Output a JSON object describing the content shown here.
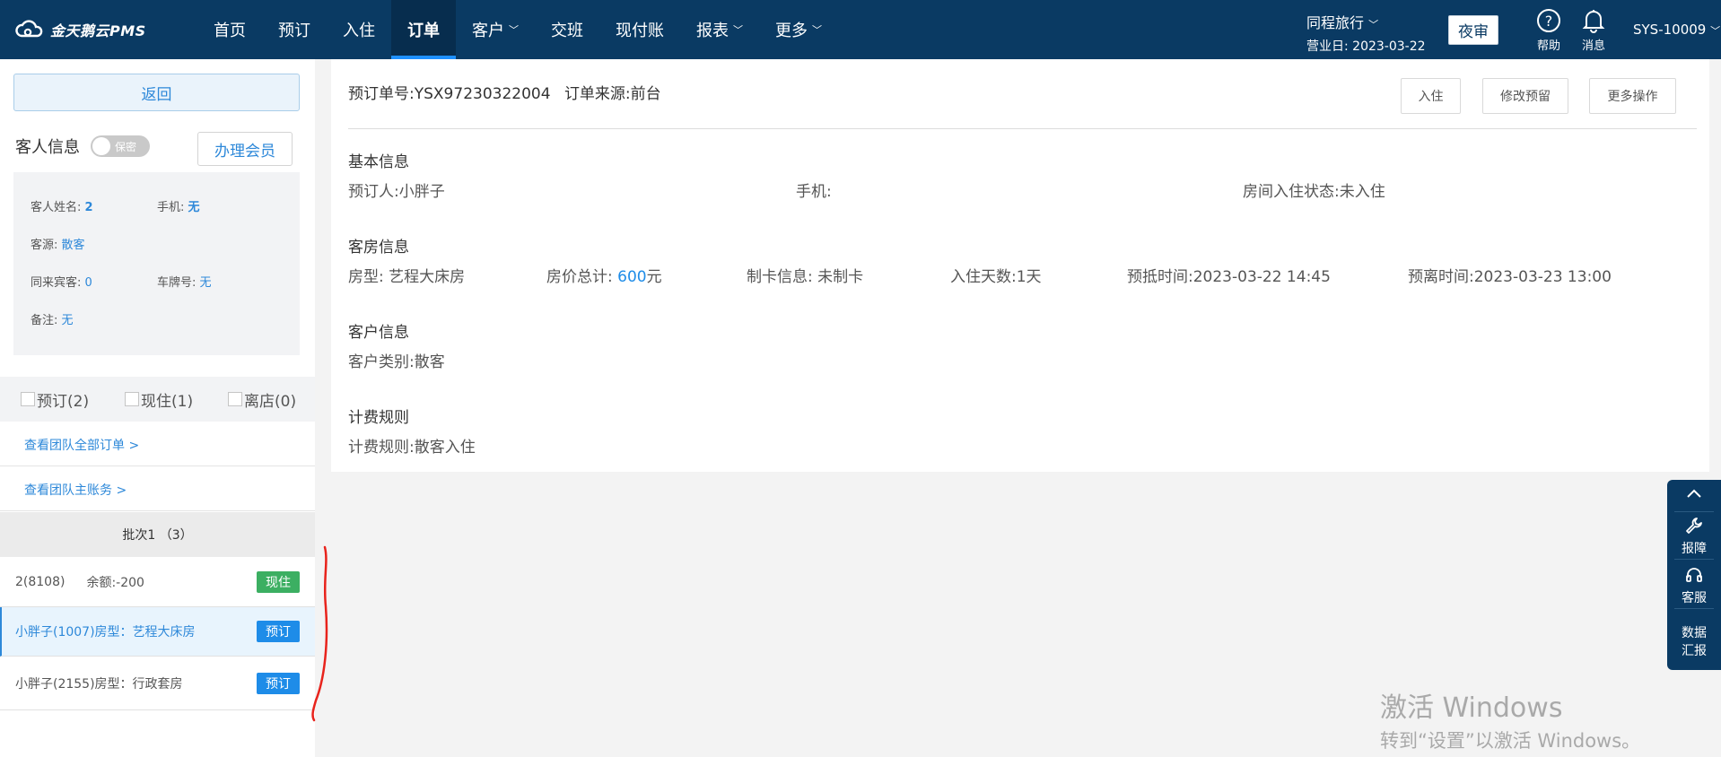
{
  "app": {
    "logo_text": "金天鹅云PMS"
  },
  "nav": {
    "items": [
      {
        "label": "首页",
        "has_caret": false,
        "active": false
      },
      {
        "label": "预订",
        "has_caret": false,
        "active": false
      },
      {
        "label": "入住",
        "has_caret": false,
        "active": false
      },
      {
        "label": "订单",
        "has_caret": false,
        "active": true
      },
      {
        "label": "客户",
        "has_caret": true,
        "active": false
      },
      {
        "label": "交班",
        "has_caret": false,
        "active": false
      },
      {
        "label": "现付账",
        "has_caret": false,
        "active": false
      },
      {
        "label": "报表",
        "has_caret": true,
        "active": false
      },
      {
        "label": "更多",
        "has_caret": true,
        "active": false
      }
    ]
  },
  "header_right": {
    "hotel_name": "同程旅行",
    "business_date_label": "营业日:",
    "business_date": "2023-03-22",
    "night_audit": "夜审",
    "help": "帮助",
    "messages": "消息",
    "user": "SYS-10009"
  },
  "sidebar": {
    "back": "返回",
    "guest_info_title": "客人信息",
    "privacy_toggle": "保密",
    "member_button": "办理会员",
    "guest": {
      "name_label": "客人姓名:",
      "name_value": "2",
      "phone_label": "手机:",
      "phone_value": "无",
      "source_label": "客源:",
      "source_value": "散客",
      "companions_label": "同来宾客:",
      "companions_value": "0",
      "plate_label": "车牌号:",
      "plate_value": "无",
      "remark_label": "备注:",
      "remark_value": "无"
    },
    "filters": [
      {
        "label": "预订(2)",
        "checked": false
      },
      {
        "label": "现住(1)",
        "checked": false
      },
      {
        "label": "离店(0)",
        "checked": false
      }
    ],
    "team_all_orders": "查看团队全部订单 >",
    "team_master_account": "查看团队主账务 >",
    "batch_label": "批次1 （3）",
    "rooms": [
      {
        "text": "2(8108)",
        "extra": "余额:-200",
        "tag": "现住",
        "tag_color": "#3caf62",
        "selected": false
      },
      {
        "text": "小胖子(1007)房型：艺程大床房",
        "extra": "",
        "tag": "预订",
        "tag_color": "#1e8ce8",
        "selected": true
      },
      {
        "text": "小胖子(2155)房型：行政套房",
        "extra": "",
        "tag": "预订",
        "tag_color": "#1e8ce8",
        "selected": false
      }
    ]
  },
  "order": {
    "number_label": "预订单号:",
    "number": "YSX97230322004",
    "source_label": "订单来源:",
    "source": "前台",
    "buttons": {
      "checkin": "入住",
      "modify": "修改预留",
      "more": "更多操作"
    }
  },
  "basic_info": {
    "title": "基本信息",
    "booker_label": "预订人:",
    "booker": "小胖子",
    "phone_label": "手机:",
    "phone": "",
    "status_label": "房间入住状态:",
    "status": "未入住"
  },
  "room_info": {
    "title": "客房信息",
    "type_label": "房型:",
    "type": "艺程大床房",
    "total_label": "房价总计:",
    "total": "600",
    "total_unit": "元",
    "card_label": "制卡信息:",
    "card": "未制卡",
    "days_label": "入住天数:",
    "days": "1天",
    "arrive_label": "预抵时间:",
    "arrive": "2023-03-22 14:45",
    "depart_label": "预离时间:",
    "depart": "2023-03-23 13:00"
  },
  "customer_info": {
    "title": "客户信息",
    "category_label": "客户类别:",
    "category": "散客"
  },
  "billing_rule": {
    "title": "计费规则",
    "rule_label": "计费规则:",
    "rule": "散客入住"
  },
  "float_bar": {
    "report": "报障",
    "service": "客服",
    "data_line1": "数据",
    "data_line2": "汇报"
  },
  "watermark": {
    "line1": "激活 Windows",
    "line2": "转到“设置”以激活 Windows。"
  },
  "colors": {
    "nav_bg": "#0a3a63",
    "accent_blue": "#1e8ce8",
    "tag_green": "#3caf62",
    "annotation_red": "#e8231c"
  }
}
